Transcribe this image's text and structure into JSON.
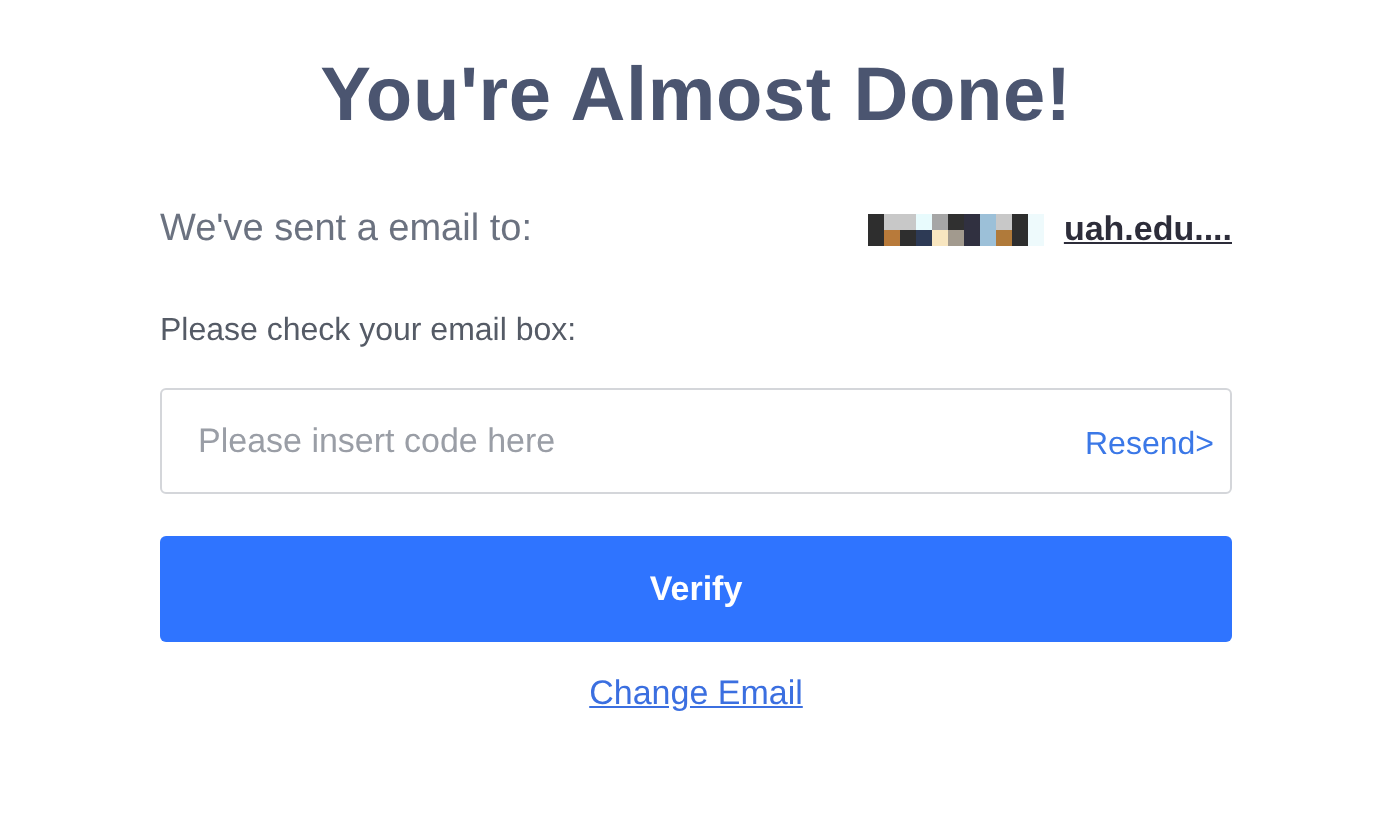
{
  "title": "You're Almost Done!",
  "sent_label": "We've sent a email to:",
  "email": {
    "kind": "redacted",
    "visible": "uah.edu...."
  },
  "instruction": "Please check your email box:",
  "code_field": {
    "placeholder": "Please insert code here"
  },
  "resend_link": "Resend>",
  "verify_button": "Verify",
  "change_email_link": "Change Email"
}
